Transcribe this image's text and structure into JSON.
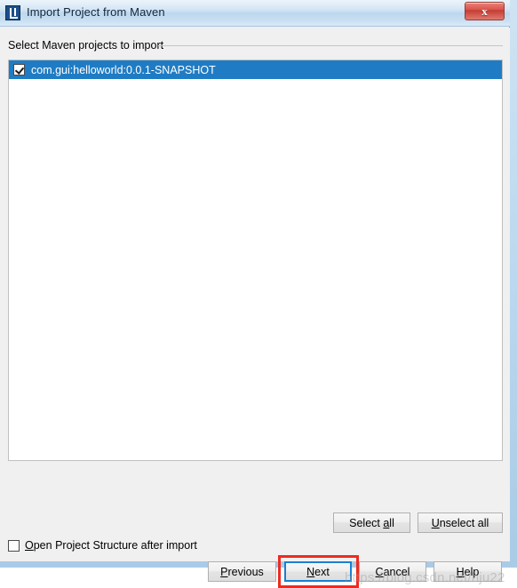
{
  "window": {
    "title": "Import Project from Maven",
    "app_icon": "intellij-idea-icon",
    "close_label": "x"
  },
  "group": {
    "label": "Select Maven projects to import"
  },
  "project_list": {
    "items": [
      {
        "label": "com.gui:helloworld:0.0.1-SNAPSHOT",
        "checked": true,
        "selected": true
      }
    ]
  },
  "list_actions": {
    "select_all": {
      "pre": "Select ",
      "mnemonic": "a",
      "post": "ll"
    },
    "unselect_all": {
      "pre": "",
      "mnemonic": "U",
      "post": "nselect all"
    }
  },
  "options": {
    "open_structure": {
      "pre": "",
      "mnemonic": "O",
      "post": "pen Project Structure after import",
      "checked": false
    }
  },
  "buttons": {
    "previous": {
      "pre": "",
      "mnemonic": "P",
      "post": "revious"
    },
    "next": {
      "pre": "",
      "mnemonic": "N",
      "post": "ext",
      "focused": true
    },
    "cancel": {
      "pre": "",
      "mnemonic": "C",
      "post": "ancel"
    },
    "help": {
      "pre": "",
      "mnemonic": "H",
      "post": "elp"
    }
  },
  "annotation": {
    "target": "next-button",
    "color": "#ee2a21"
  },
  "watermark": {
    "text": "https://blog.csdn.net/hju22"
  },
  "colors": {
    "selection_blue": "#1f7cc4",
    "focus_blue": "#1b7fd0",
    "dialog_bg": "#f0f0f0",
    "titlebar_blue": "#cbe0f2",
    "close_red": "#d9544a",
    "annotation_red": "#ee2a21"
  }
}
